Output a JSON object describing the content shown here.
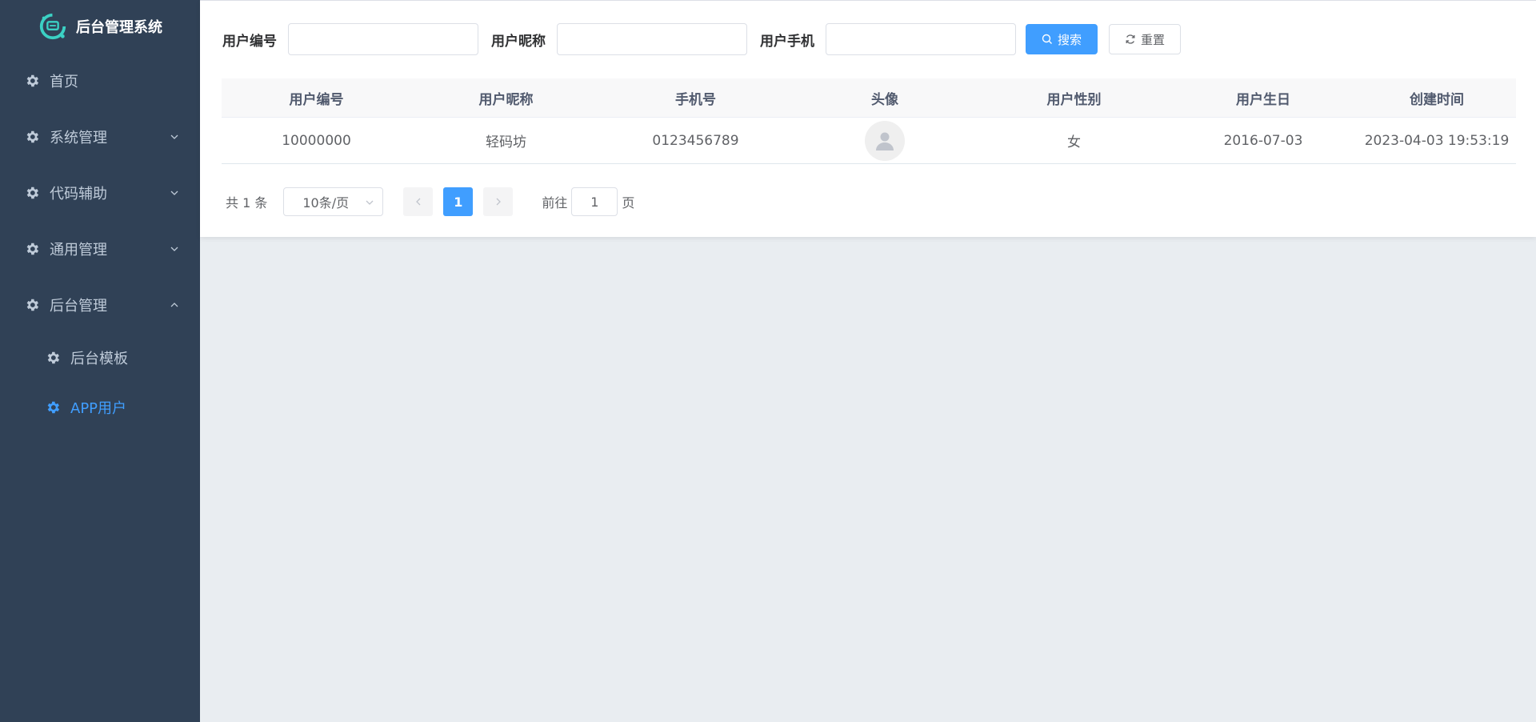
{
  "app": {
    "title": "后台管理系统"
  },
  "sidebar": {
    "items": [
      {
        "label": "首页",
        "has_arrow": false
      },
      {
        "label": "系统管理",
        "arrow": "down"
      },
      {
        "label": "代码辅助",
        "arrow": "down"
      },
      {
        "label": "通用管理",
        "arrow": "down"
      },
      {
        "label": "后台管理",
        "arrow": "up"
      }
    ],
    "subitems": [
      {
        "label": "后台模板",
        "active": false
      },
      {
        "label": "APP用户",
        "active": true
      }
    ]
  },
  "search": {
    "fields": [
      {
        "label": "用户编号",
        "value": "",
        "placeholder": ""
      },
      {
        "label": "用户昵称",
        "value": "",
        "placeholder": ""
      },
      {
        "label": "用户手机",
        "value": "",
        "placeholder": ""
      }
    ],
    "search_label": "搜索",
    "reset_label": "重置"
  },
  "table": {
    "columns": [
      "用户编号",
      "用户昵称",
      "手机号",
      "头像",
      "用户性别",
      "用户生日",
      "创建时间"
    ],
    "rows": [
      {
        "id": "10000000",
        "nickname": "轻码坊",
        "phone": "0123456789",
        "gender": "女",
        "birthday": "2016-07-03",
        "created": "2023-04-03 19:53:19"
      }
    ]
  },
  "pagination": {
    "total_text": "共 1 条",
    "page_size": "10条/页",
    "current_page": "1",
    "goto_label": "前往",
    "goto_value": "1",
    "page_suffix": "页"
  },
  "colors": {
    "sidebar_bg": "#304156",
    "accent": "#409eff",
    "page_bg": "#e9edf1"
  }
}
